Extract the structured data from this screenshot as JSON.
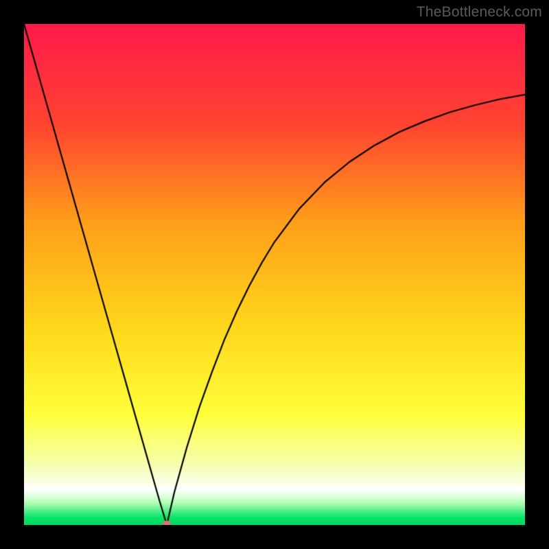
{
  "watermark": {
    "text": "TheBottleneck.com"
  },
  "chart_data": {
    "type": "line",
    "title": "",
    "xlabel": "",
    "ylabel": "",
    "xlim": [
      0,
      100
    ],
    "ylim": [
      0,
      100
    ],
    "grid": false,
    "legend": null,
    "background_gradient_stops": [
      {
        "pos": 0.0,
        "color": "#ff1a4b"
      },
      {
        "pos": 0.2,
        "color": "#ff4430"
      },
      {
        "pos": 0.4,
        "color": "#ffa01a"
      },
      {
        "pos": 0.6,
        "color": "#ffd61a"
      },
      {
        "pos": 0.78,
        "color": "#ffff3a"
      },
      {
        "pos": 0.88,
        "color": "#f5ffb0"
      },
      {
        "pos": 0.93,
        "color": "#ffffff"
      },
      {
        "pos": 0.955,
        "color": "#b7ffb7"
      },
      {
        "pos": 0.985,
        "color": "#05e56a"
      },
      {
        "pos": 1.0,
        "color": "#00d85c"
      }
    ],
    "series": [
      {
        "name": "left-branch",
        "x": [
          0.0,
          2.5,
          5.0,
          7.5,
          10.0,
          12.5,
          15.0,
          17.5,
          20.0,
          22.5,
          25.0,
          27.0,
          28.5
        ],
        "values": [
          100.0,
          91.2,
          82.4,
          73.6,
          64.8,
          56.0,
          47.2,
          38.4,
          29.6,
          20.8,
          12.0,
          5.0,
          0.0
        ]
      },
      {
        "name": "right-branch",
        "x": [
          28.5,
          30.0,
          32.5,
          35.0,
          37.5,
          40.0,
          42.5,
          45.0,
          47.5,
          50.0,
          55.0,
          60.0,
          65.0,
          70.0,
          75.0,
          80.0,
          85.0,
          90.0,
          95.0,
          100.0
        ],
        "values": [
          0.0,
          6.5,
          15.5,
          23.5,
          30.5,
          37.0,
          42.7,
          47.8,
          52.4,
          56.5,
          63.2,
          68.4,
          72.5,
          75.8,
          78.5,
          80.6,
          82.4,
          83.8,
          85.0,
          85.9
        ]
      }
    ],
    "marker": {
      "name": "minimum-point",
      "x": 28.5,
      "y": 0.0,
      "color": "#d9736e",
      "rx": 6,
      "ry": 4.5
    }
  }
}
